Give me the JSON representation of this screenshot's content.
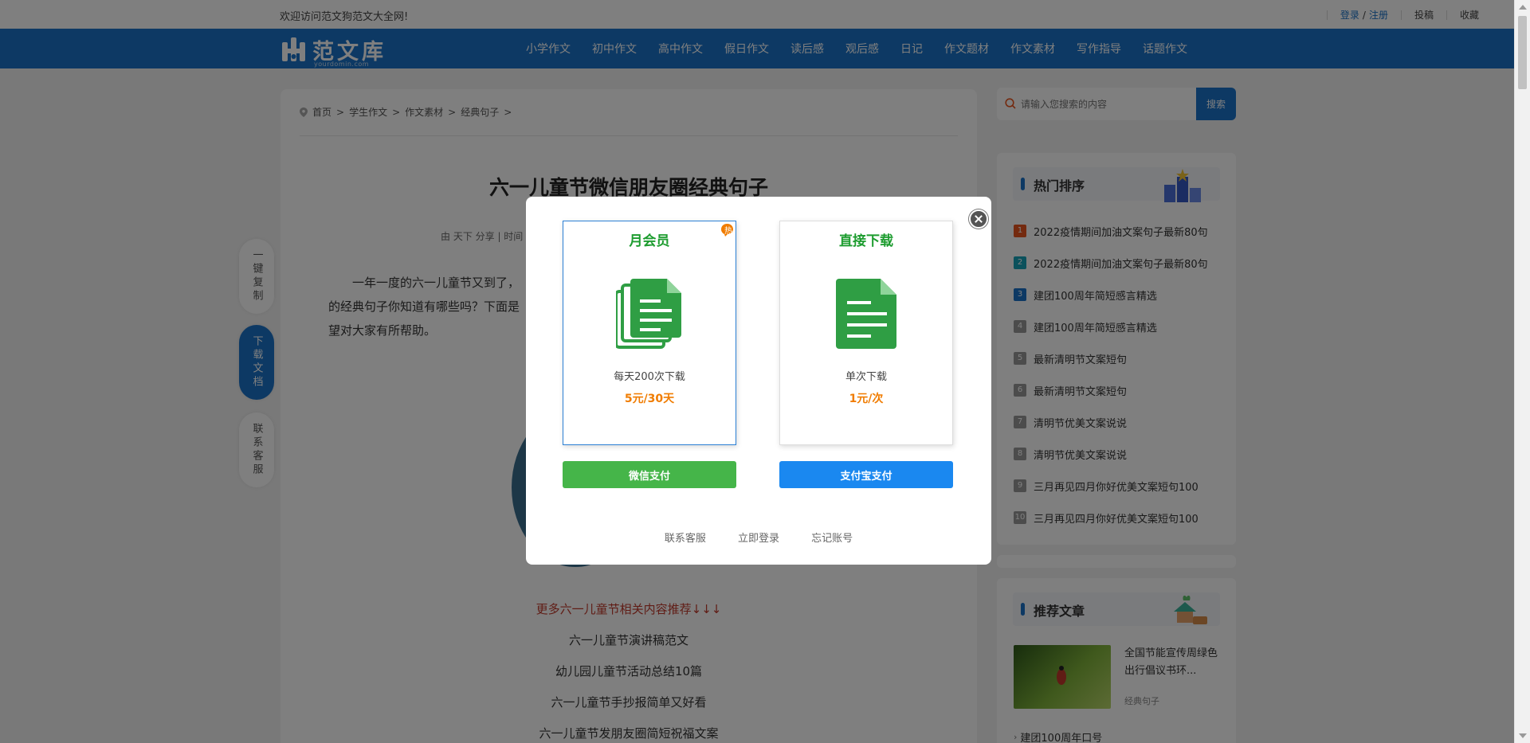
{
  "topbar": {
    "welcome": "欢迎访问范文狗范文大全网!",
    "login": "登录",
    "slash": "/",
    "register": "注册",
    "contribute": "投稿",
    "favorite": "收藏"
  },
  "logo": {
    "name": "范文库",
    "domain": "yourdomin.com"
  },
  "nav": [
    "小学作文",
    "初中作文",
    "高中作文",
    "假日作文",
    "读后感",
    "观后感",
    "日记",
    "作文题材",
    "作文素材",
    "写作指导",
    "话题作文"
  ],
  "breadcrumb": {
    "home": "首页",
    "sep": ">",
    "c1": "学生作文",
    "c2": "作文素材",
    "c3": "经典句子"
  },
  "article": {
    "title": "六一儿童节微信朋友圈经典句子",
    "meta": "由 天下 分享  |  时间",
    "intro_1": "一年一度的六一儿童节又到了，",
    "intro_2": "的经典句子你知道有哪些吗？下面是",
    "intro_3": "望对大家有所帮助。"
  },
  "related": {
    "more": "更多六一儿童节相关内容推荐↓↓↓",
    "items": [
      "六一儿童节演讲稿范文",
      "幼儿园儿童节活动总结10篇",
      "六一儿童节手抄报简单又好看",
      "六一儿童节发朋友圈简短祝福文案"
    ]
  },
  "side_buttons": {
    "copy": "一键复制",
    "download": "下载文档",
    "service": "联系客服"
  },
  "search": {
    "placeholder": "请输入您搜索的内容",
    "button": "搜索"
  },
  "hot": {
    "heading": "热门排序",
    "items": [
      {
        "n": "1",
        "t": "2022疫情期间加油文案句子最新80句"
      },
      {
        "n": "2",
        "t": "2022疫情期间加油文案句子最新80句"
      },
      {
        "n": "3",
        "t": "建团100周年简短感言精选"
      },
      {
        "n": "4",
        "t": "建团100周年简短感言精选"
      },
      {
        "n": "5",
        "t": "最新清明节文案短句"
      },
      {
        "n": "6",
        "t": "最新清明节文案短句"
      },
      {
        "n": "7",
        "t": "清明节优美文案说说"
      },
      {
        "n": "8",
        "t": "清明节优美文案说说"
      },
      {
        "n": "9",
        "t": "三月再见四月你好优美文案短句100"
      },
      {
        "n": "10",
        "t": "三月再见四月你好优美文案短句100"
      }
    ],
    "colors": [
      "#e8541e",
      "#17a2b8",
      "#1a73c8",
      "#999999",
      "#999999",
      "#999999",
      "#999999",
      "#999999",
      "#999999",
      "#999999"
    ]
  },
  "recommend": {
    "heading": "推荐文章",
    "item_title": "全国节能宣传周绿色出行倡议书环...",
    "item_cat": "经典句子",
    "next": "建团100周年口号"
  },
  "modal": {
    "monthly": {
      "title": "月会员",
      "desc": "每天200次下载",
      "price": "5元/30天",
      "badge": "热"
    },
    "direct": {
      "title": "直接下载",
      "desc": "单次下载",
      "price": "1元/次"
    },
    "wechat_pay": "微信支付",
    "alipay": "支付宝支付",
    "contact": "联系客服",
    "login_now": "立即登录",
    "forgot": "忘记账号",
    "colors": {
      "green": "#1d9c2f",
      "wechat": "#45b549",
      "alipay": "#1a88f0",
      "price": "#f07c00"
    }
  }
}
